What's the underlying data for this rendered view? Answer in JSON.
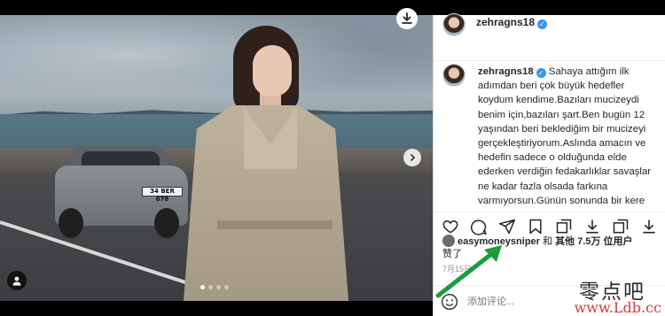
{
  "post": {
    "username": "zehragns18",
    "verified": true,
    "plate_text": "34 BER 678",
    "caption_username": "zehragns18",
    "caption_text": "Sahaya attığım ilk adımdan beri çok büyük hedefler koydum kendime.Bazıları mucizeydi benim için,bazıları şart.Ben bugün 12 yaşından beri beklediğim bir mucizeyi gerçekleştiriyorum.Aslında amacın ve hedefin sadece o olduğunda elde ederken verdiğin fedakarlıklar savaşlar ne kadar fazla olsada farkına varmıyorsun.Günün sonunda bir kere daha neden \"She's Mercedes\"",
    "likes_user": "easymoneysniper",
    "likes_connector": "和",
    "likes_others": "其他 7.5万 位用户",
    "likes_suffix": "赞了",
    "date": "7月15日",
    "comment_placeholder": "添加评论...",
    "carousel_total": 4,
    "carousel_active": 1
  },
  "icons": {
    "download": "download-icon",
    "next": "chevron-right-icon",
    "user_tag": "user-icon",
    "like": "heart-icon",
    "comment": "comment-icon",
    "share": "send-icon",
    "save": "bookmark-icon",
    "emoji": "smiley-icon",
    "verified": "verified-badge-icon"
  },
  "watermark": {
    "line1": "零点吧",
    "line2": "www.Ldb.cc"
  },
  "colors": {
    "verified_blue": "#3897f0",
    "annotation_arrow": "#1a9e3c",
    "watermark_red": "#d23b3b"
  }
}
